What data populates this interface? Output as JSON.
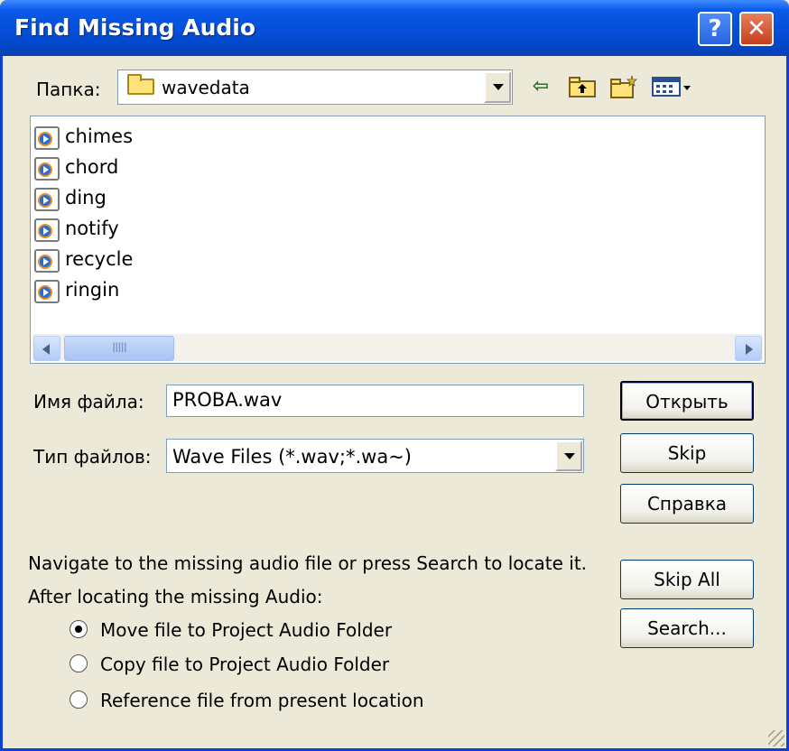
{
  "window": {
    "title": "Find Missing Audio",
    "help_label": "?",
    "close_label": "✕"
  },
  "folder": {
    "label": "Папка:",
    "value": "wavedata",
    "icons": [
      "back-arrow-icon",
      "up-folder-icon",
      "new-folder-icon",
      "view-menu-icon"
    ]
  },
  "files": [
    {
      "name": "chimes"
    },
    {
      "name": "chord"
    },
    {
      "name": "ding"
    },
    {
      "name": "notify"
    },
    {
      "name": "recycle"
    },
    {
      "name": "ringin"
    }
  ],
  "scrollbar": {
    "thumb_label": "IIIII"
  },
  "filename": {
    "label": "Имя файла:",
    "value": "PROBA.wav"
  },
  "filetype": {
    "label": "Тип файлов:",
    "value": "Wave Files (*.wav;*.wa~)"
  },
  "buttons": {
    "open": "Открыть",
    "skip": "Skip",
    "help": "Справка",
    "skip_all": "Skip All",
    "search": "Search..."
  },
  "instructions": {
    "line1": "Navigate to the missing audio file or press Search to locate it.",
    "line2": "After locating the missing Audio:"
  },
  "options": [
    {
      "label": "Move file to Project Audio Folder",
      "checked": true
    },
    {
      "label": "Copy file to Project Audio Folder",
      "checked": false
    },
    {
      "label": "Reference file from present location",
      "checked": false
    }
  ],
  "colors": {
    "titlebar": "#0550DA",
    "face": "#ECE9D8",
    "field_border": "#7F9DB9"
  }
}
